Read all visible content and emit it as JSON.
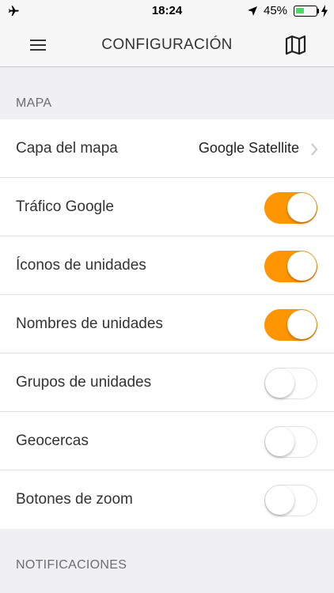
{
  "status_bar": {
    "time": "18:24",
    "battery_percent": "45%",
    "battery_level": 0.45,
    "icons": [
      "airplane-icon",
      "location-arrow-icon",
      "battery-icon",
      "charging-bolt-icon"
    ]
  },
  "nav": {
    "title": "CONFIGURACIÓN",
    "left_icon": "hamburger-menu-icon",
    "right_icon": "map-icon"
  },
  "sections": {
    "mapa": {
      "header": "MAPA",
      "layer_row": {
        "label": "Capa del mapa",
        "value": "Google Satellite"
      },
      "toggles": [
        {
          "label": "Tráfico Google",
          "on": true
        },
        {
          "label": "Íconos de unidades",
          "on": true
        },
        {
          "label": "Nombres de unidades",
          "on": true
        },
        {
          "label": "Grupos de unidades",
          "on": false
        },
        {
          "label": "Geocercas",
          "on": false
        },
        {
          "label": "Botones de zoom",
          "on": false
        }
      ]
    },
    "notificaciones": {
      "header": "NOTIFICACIONES"
    }
  },
  "colors": {
    "accent": "#ff9500",
    "background": "#efeff4",
    "battery": "#4cd964"
  }
}
